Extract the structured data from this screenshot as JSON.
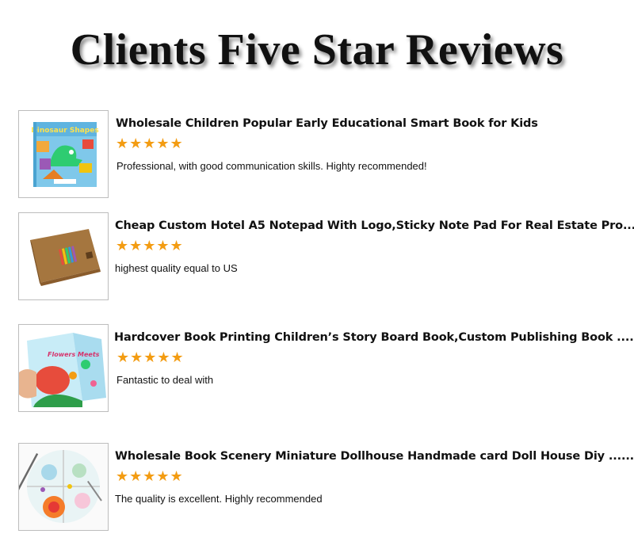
{
  "page": {
    "title": "Clients Five Star Reviews"
  },
  "rating_glyphs": "★★★★★",
  "star_color": "#f39c12",
  "reviews": [
    {
      "product": "Wholesale Children Popular Early Educational Smart Book for Kids",
      "rating": 5,
      "comment": "Professional, with good communication skills. Highty recommended!",
      "thumbnail_title": "Dinosaur Shapes"
    },
    {
      "product": "Cheap Custom Hotel A5 Notepad With Logo,Sticky Note Pad For Real Estate Pro.....",
      "rating": 5,
      "comment": "highest quality equal to US"
    },
    {
      "product": "Hardcover Book Printing Children’s Story Board Book,Custom Publishing Book .....",
      "rating": 5,
      "comment": "Fantastic to deal with",
      "thumbnail_title": "Flowers Meets"
    },
    {
      "product": "Wholesale Book Scenery Miniature Dollhouse Handmade card Doll House Diy ..........",
      "rating": 5,
      "comment": "The quality is excellent. Highly recommended"
    }
  ]
}
